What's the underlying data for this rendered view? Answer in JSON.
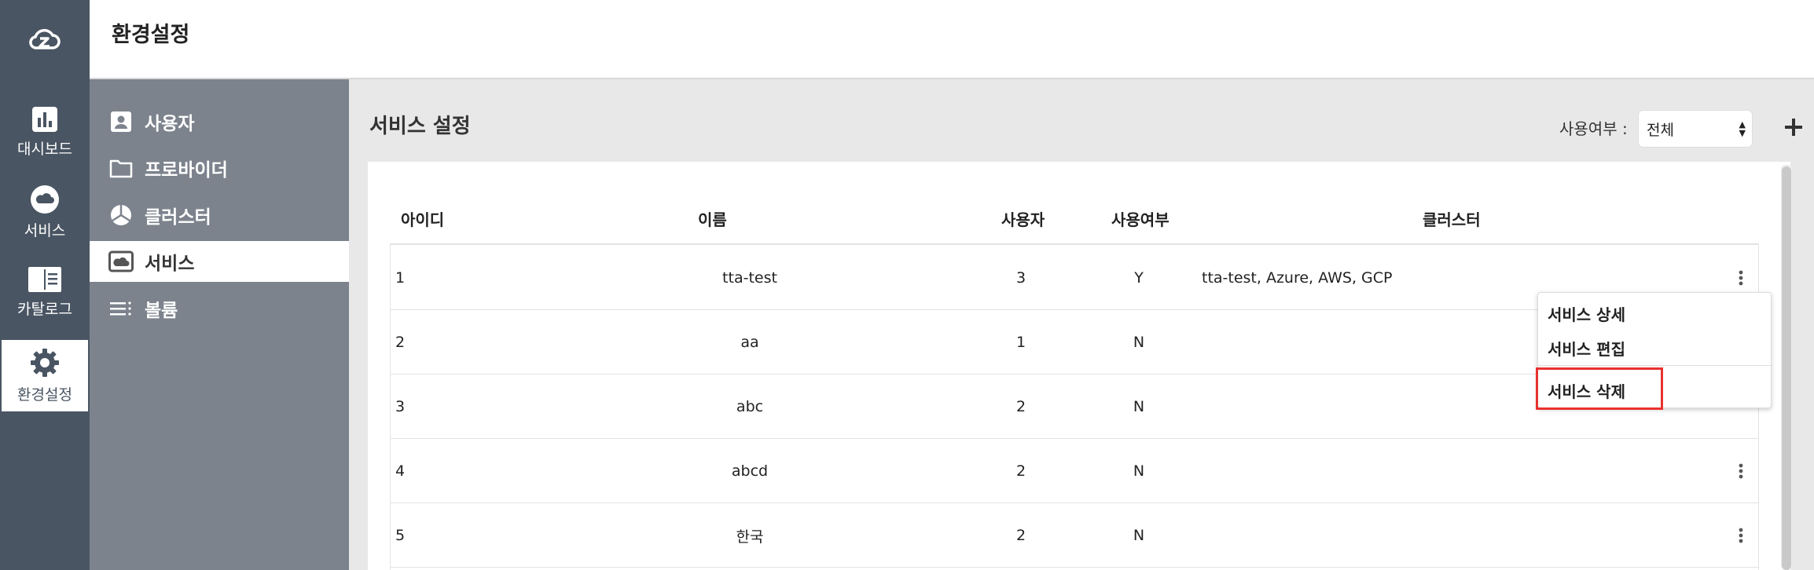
{
  "header": {
    "title": "환경설정"
  },
  "nav": {
    "items": [
      {
        "label": "대시보드",
        "icon": "bar-chart-icon"
      },
      {
        "label": "서비스",
        "icon": "cloud-icon"
      },
      {
        "label": "카탈로그",
        "icon": "book-icon"
      },
      {
        "label": "환경설정",
        "icon": "gear-icon"
      }
    ]
  },
  "subnav": {
    "items": [
      {
        "label": "사용자",
        "icon": "user-card-icon"
      },
      {
        "label": "프로바이더",
        "icon": "folder-icon"
      },
      {
        "label": "클러스터",
        "icon": "pie-icon"
      },
      {
        "label": "서비스",
        "icon": "cloud-box-icon"
      },
      {
        "label": "볼륨",
        "icon": "list-icon"
      }
    ]
  },
  "main": {
    "title": "서비스 설정",
    "filter": {
      "label": "사용여부 :",
      "value": "전체"
    }
  },
  "table": {
    "columns": [
      "아이디",
      "이름",
      "사용자",
      "사용여부",
      "클러스터"
    ],
    "rows": [
      {
        "id": "1",
        "name": "tta-test",
        "users": "3",
        "active": "Y",
        "clusters": "tta-test, Azure, AWS, GCP"
      },
      {
        "id": "2",
        "name": "aa",
        "users": "1",
        "active": "N",
        "clusters": ""
      },
      {
        "id": "3",
        "name": "abc",
        "users": "2",
        "active": "N",
        "clusters": ""
      },
      {
        "id": "4",
        "name": "abcd",
        "users": "2",
        "active": "N",
        "clusters": ""
      },
      {
        "id": "5",
        "name": "한국",
        "users": "2",
        "active": "N",
        "clusters": ""
      }
    ]
  },
  "menu": {
    "items": [
      "서비스 상세",
      "서비스 편집",
      "서비스 삭제"
    ],
    "highlighted": "서비스 삭제"
  },
  "colors": {
    "sidebar": "#4a5563",
    "submenu": "#7c838d",
    "highlight": "#e8322f"
  }
}
